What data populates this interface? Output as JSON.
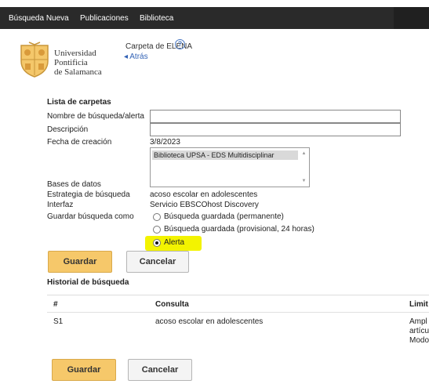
{
  "nav": {
    "new_search": "Búsqueda Nueva",
    "publications": "Publicaciones",
    "library": "Biblioteca"
  },
  "logo": {
    "line1": "Universidad",
    "line2": "Pontificia",
    "line3": "de Salamanca"
  },
  "header": {
    "folder_title": "Carpeta de ELENA",
    "help_symbol": "?",
    "back_label": "◂ Atrás"
  },
  "form": {
    "section_title": "Lista de carpetas",
    "name_label": "Nombre de búsqueda/alerta",
    "name_value": "",
    "description_label": "Descripción",
    "description_value": "",
    "created_label": "Fecha de creación",
    "created_value": "3/8/2023",
    "databases_label": "Bases de datos",
    "databases_selected": "Biblioteca UPSA - EDS Multidisciplinar",
    "strategy_label": "Estrategia de búsqueda",
    "strategy_value": "acoso escolar en adolescentes",
    "interface_label": "Interfaz",
    "interface_value": "Servicio EBSCOhost Discovery",
    "save_as_label": "Guardar búsqueda como",
    "save_options": [
      {
        "label": "Búsqueda guardada (permanente)",
        "checked": false
      },
      {
        "label": "Búsqueda guardada (provisional, 24 horas)",
        "checked": false
      },
      {
        "label": "Alerta",
        "checked": true
      }
    ],
    "highlight_color": "#f3f300"
  },
  "buttons": {
    "save": "Guardar",
    "cancel": "Cancelar"
  },
  "history": {
    "section_title": "Historial de búsqueda",
    "columns": [
      "#",
      "Consulta",
      "Limit"
    ],
    "rows": [
      {
        "id": "S1",
        "query": "acoso escolar en adolescentes",
        "limiters": "Ampl\nartícu\nModo"
      }
    ]
  }
}
